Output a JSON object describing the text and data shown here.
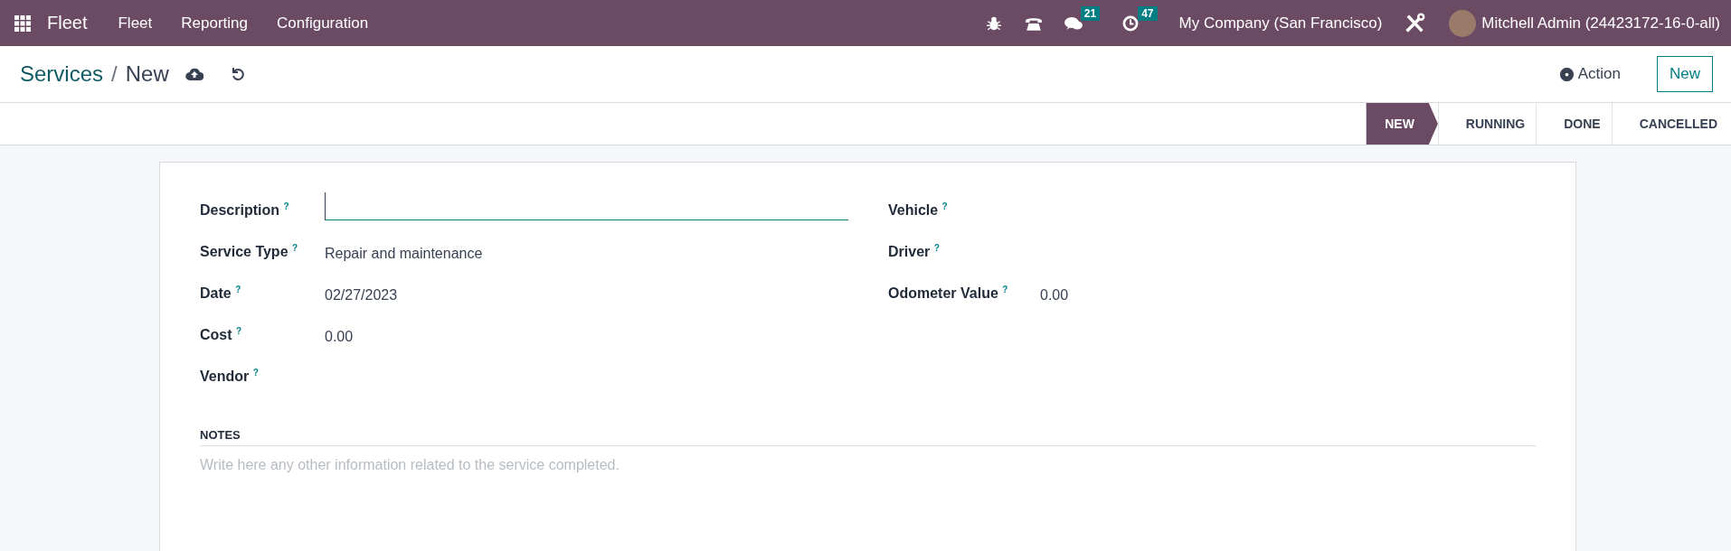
{
  "navbar": {
    "brand": "Fleet",
    "menu": [
      "Fleet",
      "Reporting",
      "Configuration"
    ],
    "systray": [
      {
        "kind": "bug"
      },
      {
        "kind": "phone"
      },
      {
        "kind": "chat",
        "badge": "21"
      },
      {
        "kind": "clock",
        "badge": "47"
      }
    ],
    "company": "My Company (San Francisco)",
    "user": "Mitchell Admin (24423172-16-0-all)"
  },
  "breadcrumb": {
    "items": [
      "Services",
      "New"
    ],
    "separator": "/"
  },
  "actions": {
    "action": "Action",
    "new": "New"
  },
  "stages": [
    {
      "label": "NEW",
      "selected": true
    },
    {
      "label": "RUNNING",
      "selected": false
    },
    {
      "label": "DONE",
      "selected": false
    },
    {
      "label": "CANCELLED",
      "selected": false
    }
  ],
  "form": {
    "left": [
      {
        "label": "Description $^{?}$",
        "kind": "input"
      },
      {
        "label": "Service Type $^{?}$",
        "kind": "text",
        "value": "Repair and maintenance"
      },
      {
        "label": "Date $^{?}$",
        "kind": "text",
        "value": "02/27/2023"
      },
      {
        "label": "Cost $^{?}$",
        "kind": "text",
        "value": "0.00"
      },
      {
        "label": "Vendor $^{?}$",
        "kind": "text"
      }
    ],
    "right": [
      {
        "label": "Vehicle $^{?}$",
        "kind": "text"
      },
      {
        "label": "Driver $^{?}$",
        "kind": "text"
      },
      {
        "label": "Odometer Value $^{?}$",
        "kind": "text",
        "value": "0.00"
      }
    ],
    "notes": {
      "title": "NOTES",
      "placeholder": "Write here any other information related to the service completed."
    }
  }
}
